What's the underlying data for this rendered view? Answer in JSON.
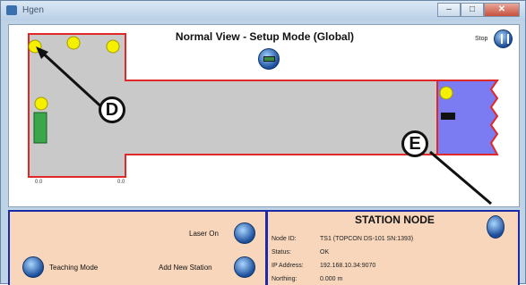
{
  "window": {
    "title": "Hgen",
    "buttons": {
      "minimize": "–",
      "maximize": "□",
      "close": "✕"
    }
  },
  "view": {
    "title": "Normal View - Setup Mode (Global)",
    "stop_label": "Stop",
    "ticks": {
      "left": "0.0",
      "right": "0.0"
    }
  },
  "left_panel": {
    "laser_on_label": "Laser On",
    "teaching_mode_label": "Teaching Mode",
    "add_station_label": "Add New Station"
  },
  "station_node": {
    "title": "STATION NODE",
    "rows": [
      {
        "key": "Node ID:",
        "value": "TS1  (TOPCON DS-101 SN:1393)"
      },
      {
        "key": "Status:",
        "value": "OK"
      },
      {
        "key": "IP Address:",
        "value": "192.168.10.34:9070"
      },
      {
        "key": "Northing:",
        "value": "0.000 m"
      }
    ]
  },
  "callouts": {
    "d": "D",
    "e": "E"
  },
  "colors": {
    "floor_fill": "#c9c9c9",
    "wall_red": "#e02828",
    "zone_fill": "#7b7cf2",
    "node_yellow": "#f5f000",
    "panel_bg": "#f8d6bb",
    "border_blue": "#1b2aa6"
  }
}
